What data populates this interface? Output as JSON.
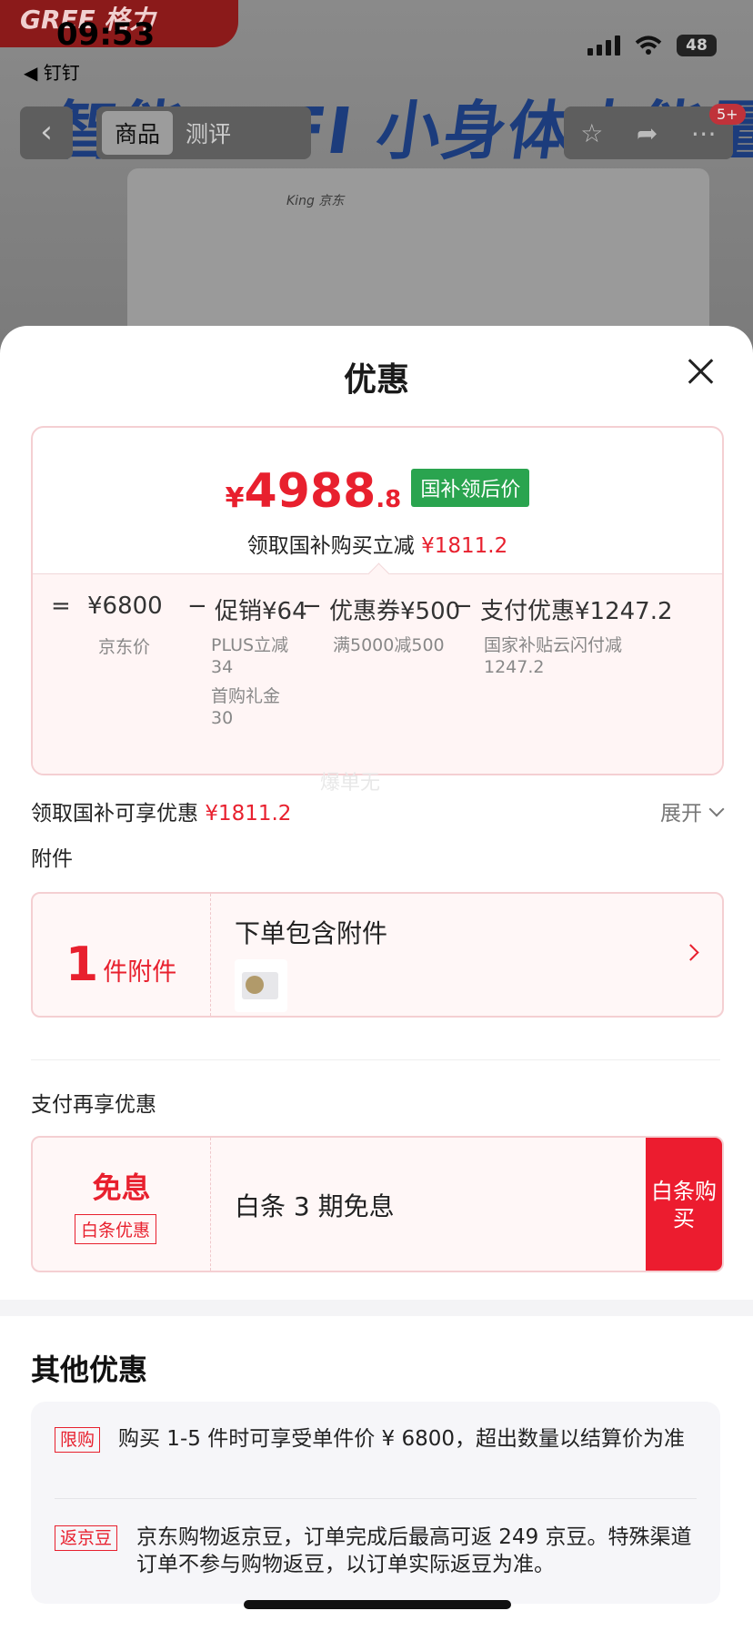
{
  "status_bar": {
    "time": "09:53",
    "back_app": "◀ 钉钉",
    "battery": "48"
  },
  "background": {
    "brand": "GREE 格力",
    "banner": "智能WIFI 小身体大能量",
    "product_logo": "King 京东",
    "nav_back": "‹",
    "tabs": [
      {
        "label": "商品"
      },
      {
        "label": "测评"
      }
    ],
    "badge": "5+"
  },
  "sheet": {
    "title": "优惠",
    "price": {
      "yen": "¥",
      "integer": "4988",
      "decimal": ".8",
      "tag": "国补领后价",
      "sub_label": "领取国补购买立减",
      "sub_value": "¥1811.2"
    },
    "calc": {
      "eq": "=",
      "jd_price": "¥6800",
      "jd_price_note": "京东价",
      "minus": "−",
      "promo": "促销¥64",
      "promo_notes": [
        "PLUS立减",
        "34",
        "首购礼金",
        "30"
      ],
      "coupon": "优惠券¥500",
      "coupon_note": "满5000减500",
      "pay": "支付优惠¥1247.2",
      "pay_notes": [
        "国家补贴云闪付减",
        "1247.2"
      ]
    },
    "watermark": "爆单无",
    "subsidy_line": {
      "label": "领取国补可享优惠",
      "value": "¥1811.2",
      "expand": "展开"
    },
    "accessory": {
      "section": "附件",
      "count": "1",
      "unit": "件附件",
      "title": "下单包含附件"
    },
    "pay_more": {
      "section": "支付再享优惠",
      "main": "免息",
      "tag": "白条优惠",
      "title": "白条 3 期免息",
      "button": "白条购买"
    },
    "other": {
      "title": "其他优惠",
      "items": [
        {
          "tag": "限购",
          "text": "购买 1-5 件时可享受单件价 ¥ 6800，超出数量以结算价为准"
        },
        {
          "tag": "返京豆",
          "text": "京东购物返京豆，订单完成后最高可返 249 京豆。特殊渠道订单不参与购物返豆，以订单实际返豆为准。"
        }
      ]
    }
  },
  "colors": {
    "accent_red": "#e8202e",
    "tag_green": "#2aa44f",
    "button_red": "#ec1c2f"
  }
}
